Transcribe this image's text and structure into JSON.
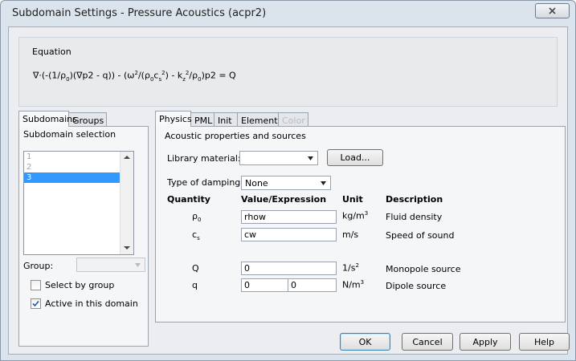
{
  "window": {
    "title": "Subdomain Settings - Pressure Acoustics (acpr2)"
  },
  "equation": {
    "group_title": "Equation",
    "formula": {
      "p1": "∇·(-(1/ρ",
      "s1": "0",
      "p2": ")(∇p2 - q)) - (ω",
      "s2": "2",
      "p3": "/(ρ",
      "s3": "0",
      "p4": "c",
      "s4": "s",
      "s5": "2",
      "p5": ") - k",
      "s6": "z",
      "s7": "2",
      "p6": "/ρ",
      "s8": "0",
      "p7": ")p2 = Q"
    }
  },
  "left_tabs": [
    {
      "label": "Subdomains",
      "active": true
    },
    {
      "label": "Groups",
      "active": false
    }
  ],
  "subdomain_panel": {
    "heading": "Subdomain selection",
    "items": [
      "1",
      "2",
      "3"
    ],
    "selected_index": 2,
    "group_label": "Group:",
    "select_by_group_label": "Select by group",
    "select_by_group_checked": false,
    "active_label": "Active in this domain",
    "active_checked": true
  },
  "right_tabs": [
    {
      "label": "Physics",
      "active": true,
      "disabled": false
    },
    {
      "label": "PML",
      "active": false,
      "disabled": false
    },
    {
      "label": "Init",
      "active": false,
      "disabled": false
    },
    {
      "label": "Element",
      "active": false,
      "disabled": false
    },
    {
      "label": "Color",
      "active": false,
      "disabled": true
    }
  ],
  "physics": {
    "group_title": "Acoustic properties and sources",
    "library_material_label": "Library material:",
    "library_material_value": "",
    "load_button": "Load...",
    "damping_label": "Type of damping",
    "damping_value": "None",
    "headers": {
      "quantity": "Quantity",
      "value": "Value/Expression",
      "unit": "Unit",
      "description": "Description"
    },
    "rows": {
      "rho": {
        "q_base": "ρ",
        "q_sub": "0",
        "value": "rhow",
        "unit_base": "kg/m",
        "unit_sup": "3",
        "description": "Fluid density"
      },
      "cs": {
        "q_base": "c",
        "q_sub": "s",
        "value": "cw",
        "unit_base": "m/s",
        "description": "Speed of sound"
      },
      "Q": {
        "q_base": "Q",
        "value": "0",
        "unit_base": "1/s",
        "unit_sup": "2",
        "description": "Monopole source"
      },
      "q": {
        "q_base": "q",
        "value1": "0",
        "value2": "0",
        "unit_base": "N/m",
        "unit_sup": "3",
        "description": "Dipole source"
      }
    }
  },
  "buttons": {
    "ok": "OK",
    "cancel": "Cancel",
    "apply": "Apply",
    "help": "Help"
  },
  "colors": {
    "selection": "#3399ff",
    "window_frame": "#dbe3ec"
  }
}
